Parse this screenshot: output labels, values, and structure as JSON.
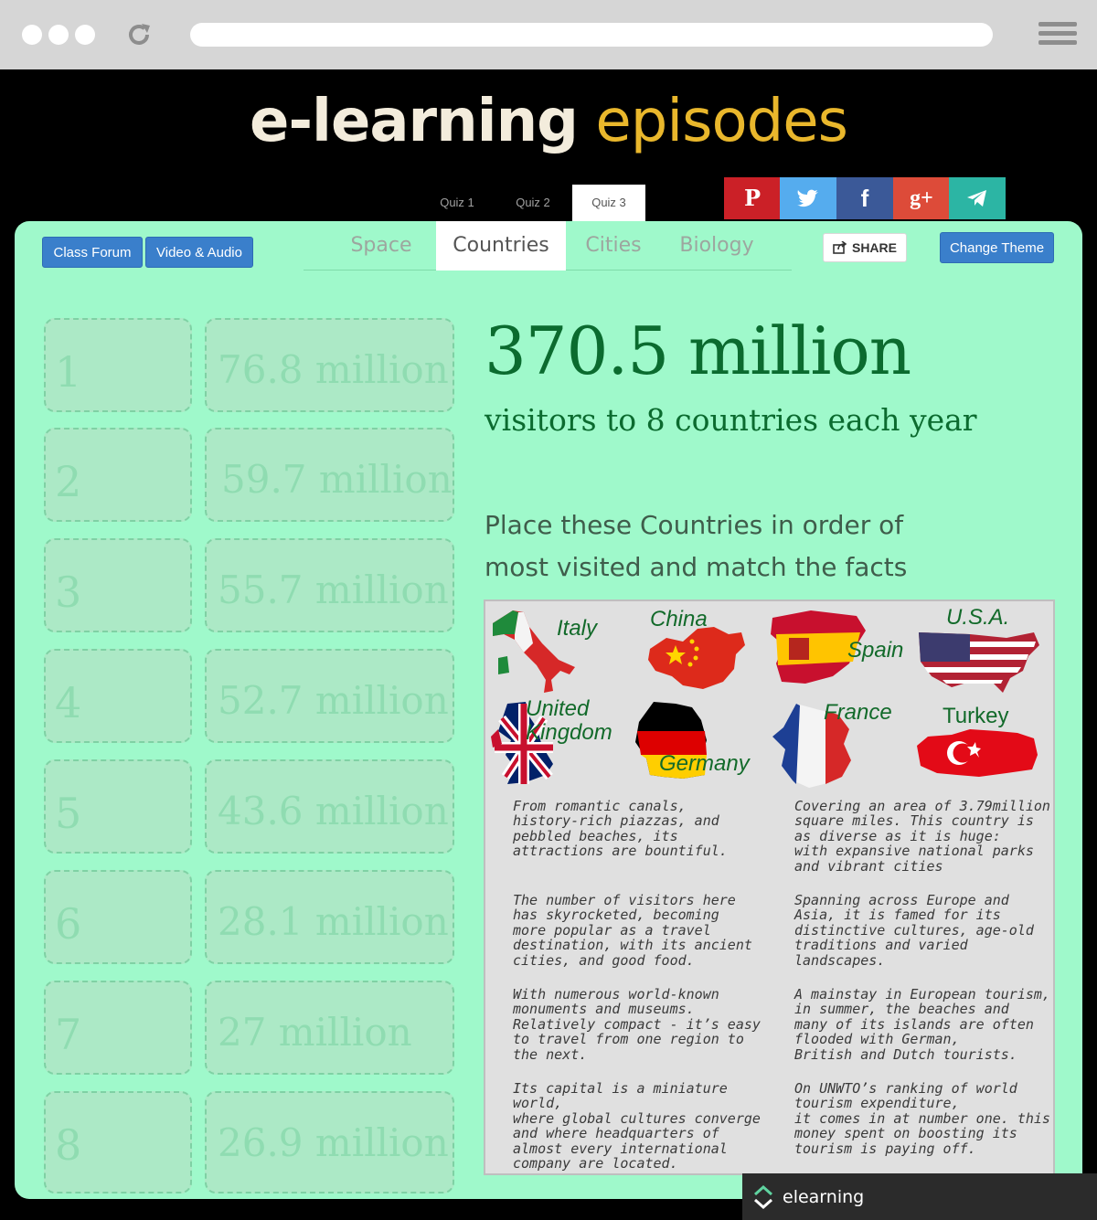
{
  "site": {
    "logo_w1": "e-learning",
    "logo_w2": "episodes"
  },
  "quiz_tabs": [
    "Quiz 1",
    "Quiz 2",
    "Quiz 3"
  ],
  "active_quiz": "Quiz 3",
  "social": [
    {
      "name": "pinterest",
      "glyph": "P",
      "color": "#cb2027"
    },
    {
      "name": "twitter",
      "glyph": "t",
      "color": "#55acee"
    },
    {
      "name": "facebook",
      "glyph": "f",
      "color": "#3b5998"
    },
    {
      "name": "google-plus",
      "glyph": "g+",
      "color": "#dd4b39"
    },
    {
      "name": "telegram",
      "glyph": "➤",
      "color": "#2cb5a4"
    }
  ],
  "toolbar": {
    "class_forum": "Class Forum",
    "video_audio": "Video & Audio",
    "share": "SHARE",
    "change_theme": "Change Theme"
  },
  "categories": [
    "Space",
    "Countries",
    "Cities",
    "Biology"
  ],
  "active_category": "Countries",
  "ranks": [
    "1",
    "2",
    "3",
    "4",
    "5",
    "6",
    "7",
    "8"
  ],
  "values": [
    "76.8 million",
    "59.7 million",
    "55.7 million",
    "52.7 million",
    "43.6 million",
    "28.1 million",
    "27 million",
    "26.9 million"
  ],
  "stat": {
    "big": "370.5 million",
    "sub": "visitors to 8 countries each year"
  },
  "instruction": {
    "line1": "Place these Countries in order of",
    "line2": "most visited and match the facts"
  },
  "countries": {
    "italy": "Italy",
    "china": "China",
    "spain": "Spain",
    "usa": "U.S.A.",
    "uk_line1": "United",
    "uk_line2": "Kingdom",
    "germany": "Germany",
    "france": "France",
    "turkey": "Turkey"
  },
  "facts_left": [
    [
      "From romantic canals,",
      "history-rich piazzas, and",
      "pebbled beaches, its",
      "attractions are bountiful."
    ],
    [
      "The number of visitors here",
      "has skyrocketed, becoming",
      "more popular as a travel",
      "destination, with its ancient",
      "cities, and good food."
    ],
    [
      "With numerous world-known",
      "monuments and museums.",
      "Relatively compact - it’s easy",
      "to travel from one region to",
      "the next."
    ],
    [
      "Its capital is a miniature world,",
      "where global cultures converge",
      "and where headquarters of",
      "almost every international",
      "company are located."
    ]
  ],
  "facts_right": [
    [
      "Covering an area of 3.79million",
      "square miles. This country is",
      "as diverse as it is huge:",
      "with expansive national parks",
      "and vibrant cities"
    ],
    [
      "Spanning across Europe and",
      "Asia, it is famed for its",
      "distinctive cultures, age-old",
      "traditions and varied",
      "landscapes."
    ],
    [
      "A mainstay in European tourism,",
      "in summer, the beaches and",
      "many of its islands are often",
      "flooded with German,",
      "British and Dutch tourists."
    ],
    [
      "On UNWTO’s ranking of world",
      "tourism expenditure,",
      "it comes in at number one. this",
      "money spent on boosting its",
      "tourism is paying off."
    ]
  ],
  "footer": {
    "label": "elearning"
  }
}
